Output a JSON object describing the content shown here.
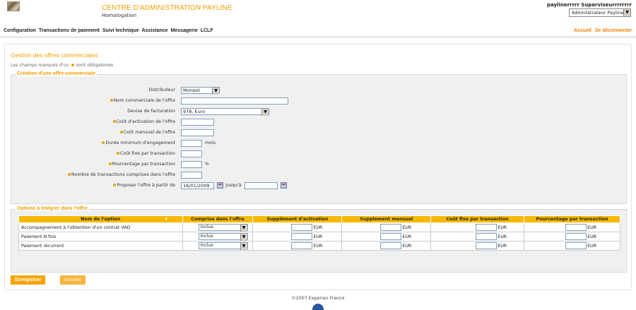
{
  "header": {
    "title": "CENTRE D'ADMINISTRATION PAYLINE",
    "subtitle": "Homologation",
    "user": "paylinerrrrr Superviseurrrrrrrr",
    "role": "Administrateur Payline"
  },
  "nav": {
    "items": [
      "Configuration",
      "Transactions de paiement",
      "Suivi technique",
      "Assistance",
      "Messagerie",
      "LCLF"
    ],
    "right": [
      "Accueil",
      "Se déconnecter"
    ]
  },
  "page": {
    "title": "Gestion des offres commerciales",
    "required_note_before": "Les champs marqués d'un",
    "required_note_after": "sont obligatoires"
  },
  "create": {
    "legend": "Création d'une offre commerciale",
    "distributor_label": "Distributeur",
    "distributor_value": "Monext",
    "name_label": "Nom commerciale de l'offre",
    "currency_label": "Devise de facturation",
    "currency_value": "978, Euro",
    "activation_label": "Coût d'activation de l'offre",
    "monthly_label": "Coût mensuel de l'offre",
    "duration_label": "Durée minimum d'engagement",
    "duration_unit": "mois",
    "fixed_label": "Coût fixe par transaction",
    "percent_label": "Pourcentage par transaction",
    "percent_unit": "%",
    "count_label": "Nombre de transactions comprises dans l'offre",
    "from_label": "Proposer l'offre à partir de",
    "from_value": "16/01/2009",
    "until_label": "jusqu'à"
  },
  "options": {
    "legend": "Options à intégrer dans l'offre",
    "headers": [
      "Nom de l'option",
      "Comprise dans l'offre",
      "Supplément d'activation",
      "Supplément mensuel",
      "Coût fixe par transaction",
      "Pourcentage par transaction"
    ],
    "unit": "EUR",
    "rows": [
      {
        "name": "Accompagnement à l'obtention d'un contrat VAD",
        "included": "Inclus"
      },
      {
        "name": "Paiement N fois",
        "included": "Inclus"
      },
      {
        "name": "Paiement récurrent",
        "included": "Inclus"
      }
    ]
  },
  "buttons": {
    "save": "Enregistrer",
    "cancel": "Annuler"
  },
  "footer": "©2007 Experian France"
}
